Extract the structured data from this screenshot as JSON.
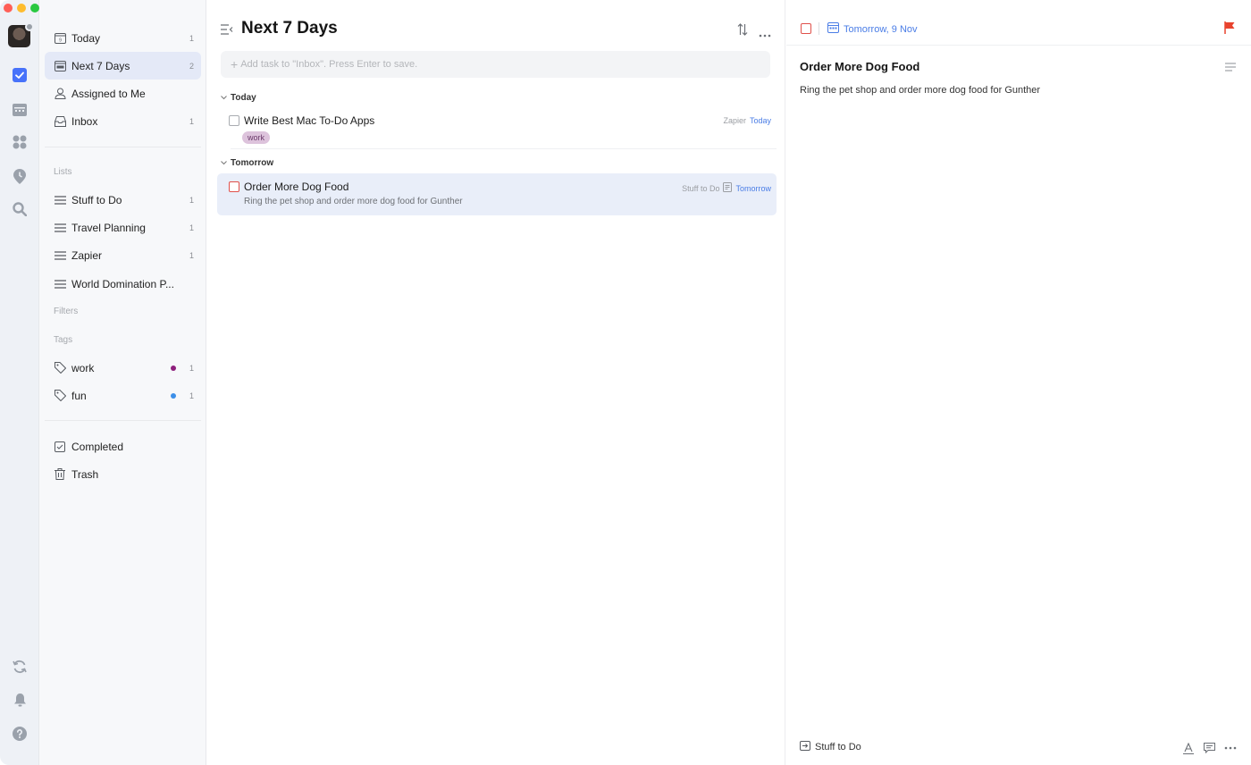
{
  "window": {
    "traffic_lights": [
      "#ff5f57",
      "#febc2e",
      "#28c840"
    ]
  },
  "rail": {
    "items": [
      "tasks-icon",
      "calendar-icon",
      "matrix-icon",
      "habit-icon",
      "search-icon",
      "sync-icon",
      "bell-icon",
      "help-icon"
    ],
    "accent": "#4772fa"
  },
  "sidebar": {
    "smart": [
      {
        "label": "Today",
        "count": "1",
        "icon": "calendar-day-icon"
      },
      {
        "label": "Next 7 Days",
        "count": "2",
        "icon": "calendar-week-icon"
      },
      {
        "label": "Assigned to Me",
        "count": "",
        "icon": "person-icon"
      },
      {
        "label": "Inbox",
        "count": "1",
        "icon": "inbox-icon"
      }
    ],
    "lists_label": "Lists",
    "lists": [
      {
        "label": "Stuff to Do",
        "count": "1"
      },
      {
        "label": "Travel Planning",
        "count": "1"
      },
      {
        "label": "Zapier",
        "count": "1"
      },
      {
        "label": "World Domination P...",
        "count": ""
      }
    ],
    "filters_label": "Filters",
    "tags_label": "Tags",
    "tags": [
      {
        "label": "work",
        "count": "1",
        "color": "#8e1f7c"
      },
      {
        "label": "fun",
        "count": "1",
        "color": "#3d8fe8"
      }
    ],
    "bottom": [
      {
        "label": "Completed",
        "icon": "check-square-icon"
      },
      {
        "label": "Trash",
        "icon": "trash-icon"
      }
    ]
  },
  "main": {
    "title": "Next 7 Days",
    "add_placeholder": "Add task to \"Inbox\". Press Enter to save.",
    "groups": [
      {
        "label": "Today",
        "tasks": [
          {
            "title": "Write Best Mac To-Do Apps",
            "list": "Zapier",
            "date": "Today",
            "tag": "work",
            "desc": ""
          }
        ]
      },
      {
        "label": "Tomorrow",
        "tasks": [
          {
            "title": "Order More Dog Food",
            "list": "Stuff to Do",
            "date": "Tomorrow",
            "tag": "",
            "desc": "Ring the pet shop and order more dog food for Gunther"
          }
        ]
      }
    ]
  },
  "detail": {
    "date": "Tomorrow, 9 Nov",
    "title": "Order More Dog Food",
    "description": "Ring the pet shop and order more dog food for Gunther",
    "list": "Stuff to Do",
    "flag_color": "#e8432e"
  }
}
